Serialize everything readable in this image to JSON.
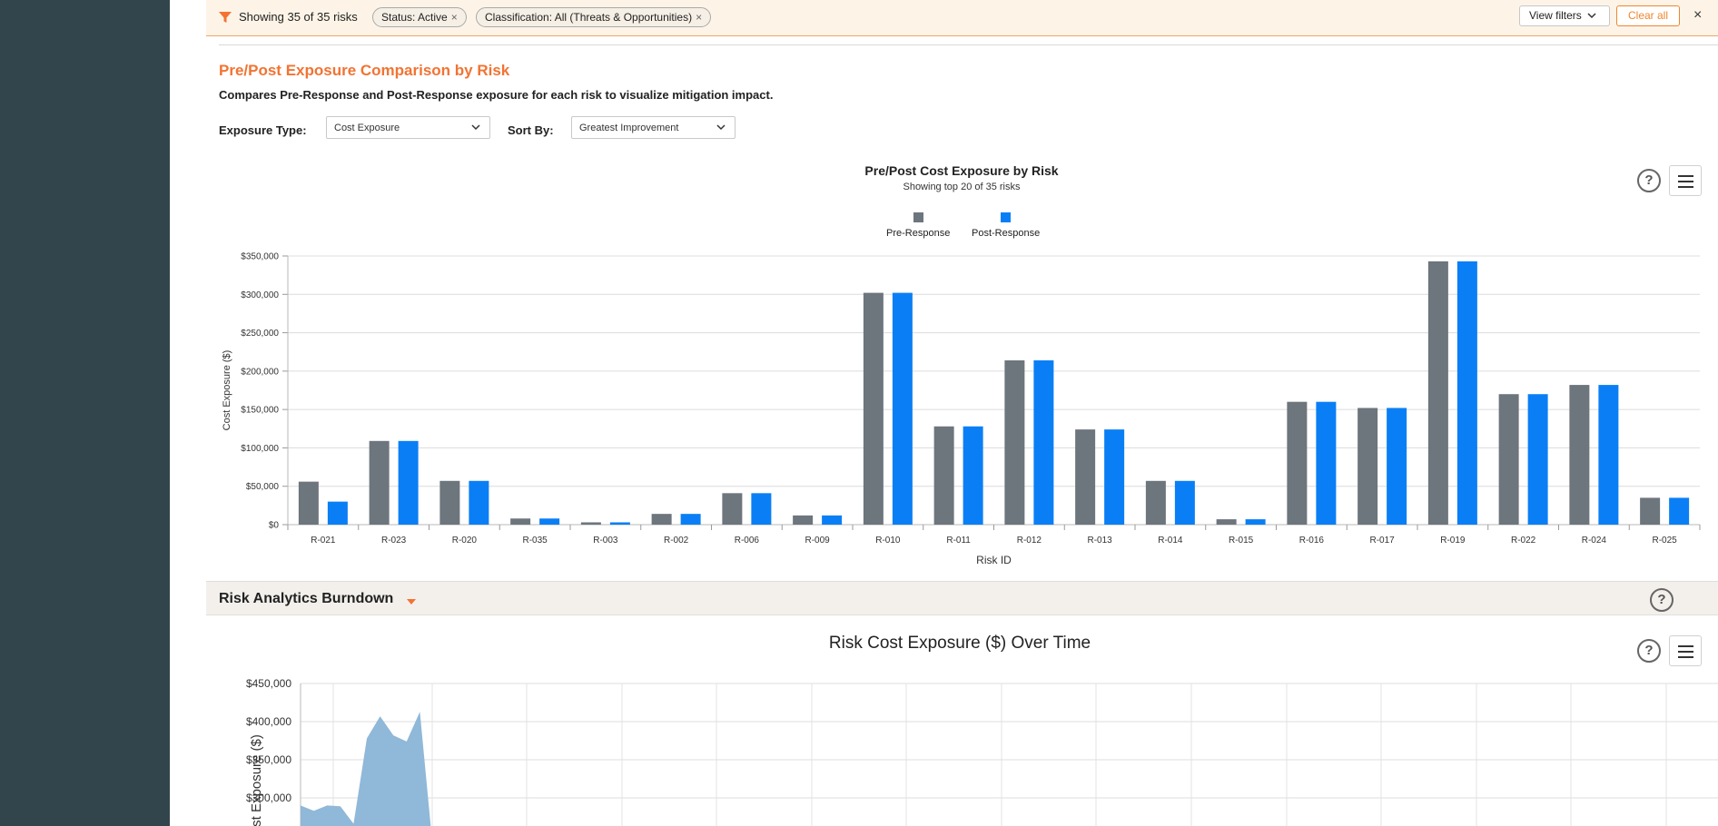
{
  "filterbar": {
    "showing": "Showing 35 of 35 risks",
    "chips": [
      {
        "label": "Status: Active",
        "close": "×"
      },
      {
        "label": "Classification: All (Threats & Opportunities)",
        "close": "×"
      }
    ],
    "view_filters": "View filters",
    "clear_all": "Clear all",
    "close": "×"
  },
  "section": {
    "title": "Pre/Post Exposure Comparison by Risk",
    "description": "Compares Pre-Response and Post-Response exposure for each risk to visualize mitigation impact."
  },
  "controls": {
    "exposure_label": "Exposure Type:",
    "exposure_value": "Cost Exposure",
    "sort_label": "Sort By:",
    "sort_value": "Greatest Improvement"
  },
  "help_text": "?",
  "chart_data": [
    {
      "type": "bar",
      "title": "Pre/Post Cost Exposure by Risk",
      "subtitle": "Showing top 20 of 35 risks",
      "xlabel": "Risk ID",
      "ylabel": "Cost Exposure ($)",
      "ylim": [
        0,
        350000
      ],
      "yticks": [
        "$0",
        "$50,000",
        "$100,000",
        "$150,000",
        "$200,000",
        "$250,000",
        "$300,000",
        "$350,000"
      ],
      "legend_position": "top-center",
      "categories": [
        "R-021",
        "R-023",
        "R-020",
        "R-035",
        "R-003",
        "R-002",
        "R-006",
        "R-009",
        "R-010",
        "R-011",
        "R-012",
        "R-013",
        "R-014",
        "R-015",
        "R-016",
        "R-017",
        "R-019",
        "R-022",
        "R-024",
        "R-025"
      ],
      "series": [
        {
          "name": "Pre-Response",
          "color": "#6d757d",
          "values": [
            56000,
            109000,
            57000,
            8000,
            3000,
            14000,
            41000,
            12000,
            302000,
            128000,
            214000,
            124000,
            57000,
            7000,
            160000,
            152000,
            343000,
            170000,
            182000,
            35000
          ]
        },
        {
          "name": "Post-Response",
          "color": "#0a7ff5",
          "values": [
            30000,
            109000,
            57000,
            8000,
            3000,
            14000,
            41000,
            12000,
            302000,
            128000,
            214000,
            124000,
            57000,
            7000,
            160000,
            152000,
            343000,
            170000,
            182000,
            35000
          ]
        }
      ]
    },
    {
      "type": "area",
      "title": "Risk Cost Exposure ($) Over Time",
      "ylabel": "Cost Exposure ($)",
      "yticks_visible": [
        "$300,000",
        "$350,000",
        "$400,000",
        "$450,000"
      ],
      "ylim_visible": [
        260000,
        450000
      ],
      "color": "#8ab4d6",
      "values": [
        290000,
        283000,
        290000,
        289000,
        266000,
        378000,
        407000,
        382000,
        374000,
        413000,
        230000
      ]
    }
  ],
  "burndown": {
    "title": "Risk Analytics Burndown"
  }
}
